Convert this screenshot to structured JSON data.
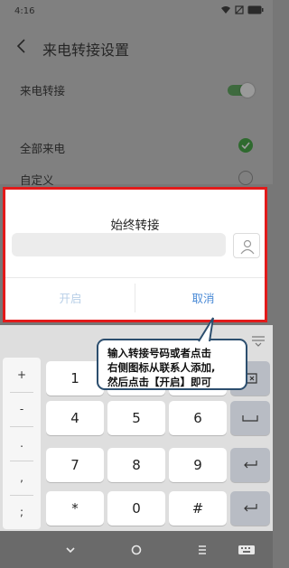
{
  "status_bar": {
    "time": "4:16",
    "battery": "67"
  },
  "settings_page": {
    "title": "来电转接设置",
    "toggle_label": "来电转接",
    "option_all": "全部来电",
    "option_custom": "自定义"
  },
  "dialog": {
    "title": "始终转接",
    "input_value": "",
    "enable_button": "开启",
    "cancel_button": "取消"
  },
  "callout": {
    "line1": "输入转接号码或者点击",
    "line2": "右侧图标从联系人添加,",
    "line3": "然后点击【开启】即可"
  },
  "keyboard": {
    "symbols": [
      "+",
      "-",
      ".",
      ",",
      ";"
    ],
    "keys": [
      "1",
      "2",
      "3",
      "4",
      "5",
      "6",
      "7",
      "8",
      "9",
      "*",
      "0",
      "#"
    ]
  },
  "colors": {
    "accent": "#4a8ad6",
    "highlight_border": "#e21a1a",
    "callout_border": "#2c4e6e"
  }
}
